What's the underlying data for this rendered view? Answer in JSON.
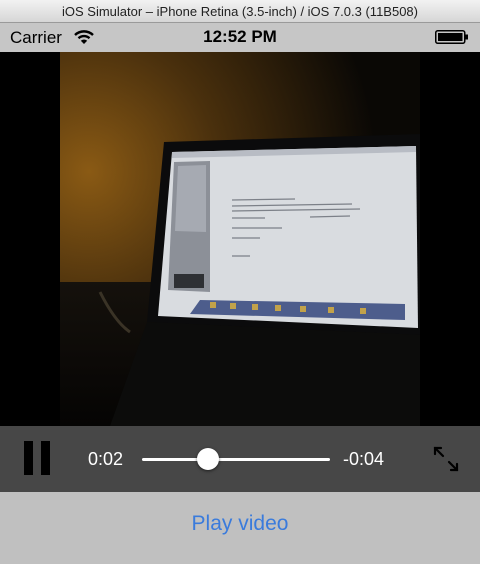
{
  "simulator": {
    "title": "iOS Simulator – iPhone Retina (3.5-inch) / iOS 7.0.3 (11B508)"
  },
  "status_bar": {
    "carrier": "Carrier",
    "time": "12:52 PM",
    "wifi_icon": "wifi-icon",
    "battery_icon": "battery-icon"
  },
  "player": {
    "elapsed": "0:02",
    "remaining": "-0:04",
    "progress": 0.33,
    "pause_icon": "pause-icon",
    "fullscreen_icon": "fullscreen-icon"
  },
  "actions": {
    "play_label": "Play video"
  },
  "colors": {
    "accent": "#3a7bdc",
    "controls_bg": "#474747",
    "status_bg": "#c6c6c6"
  }
}
